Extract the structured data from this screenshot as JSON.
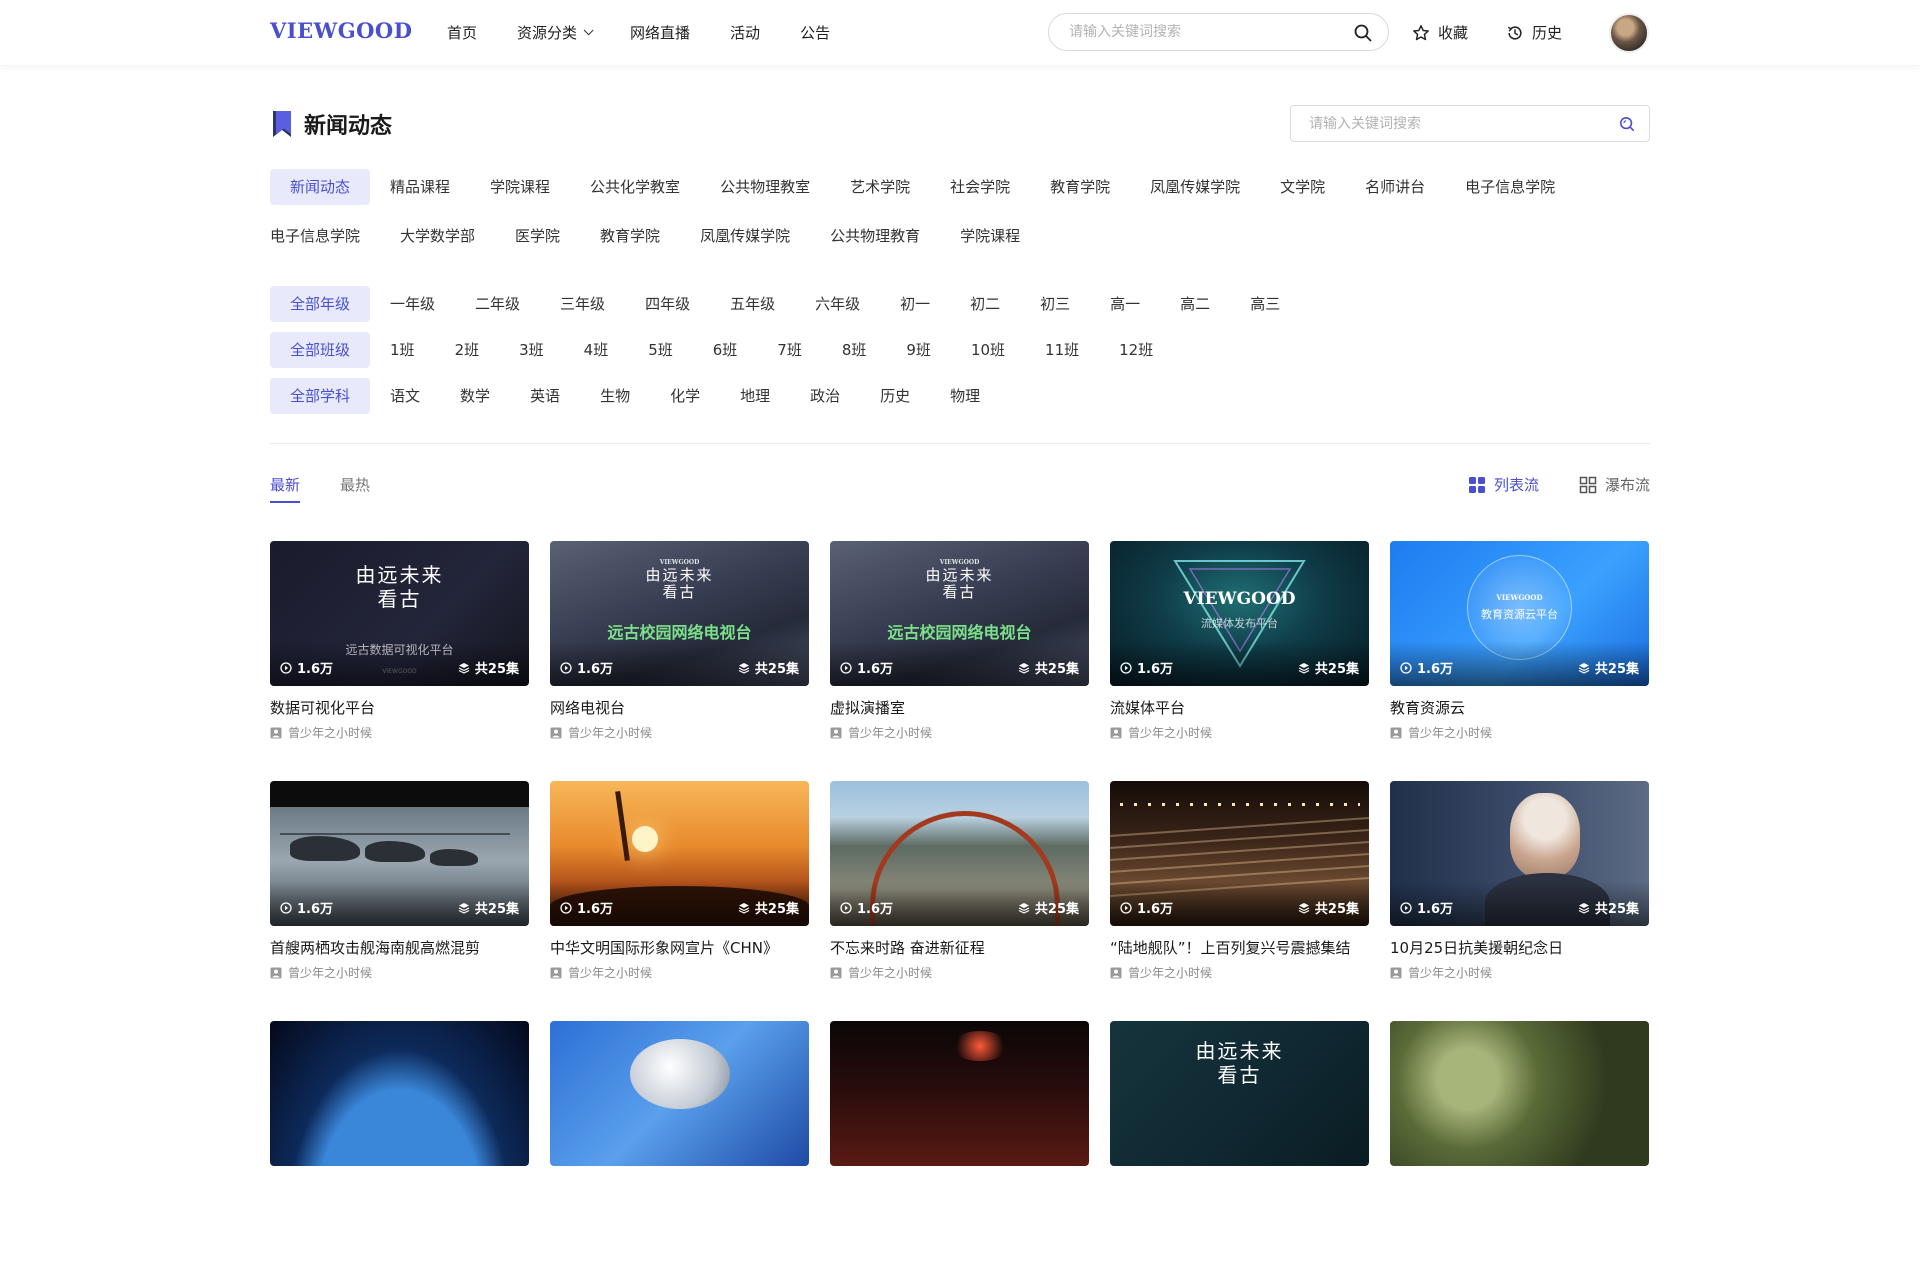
{
  "header": {
    "logo": "VIEWGOOD",
    "nav": [
      {
        "label": "首页",
        "dropdown": false
      },
      {
        "label": "资源分类",
        "dropdown": true
      },
      {
        "label": "网络直播",
        "dropdown": false
      },
      {
        "label": "活动",
        "dropdown": false
      },
      {
        "label": "公告",
        "dropdown": false
      }
    ],
    "search_placeholder": "请输入关键词搜索",
    "favorites_label": "收藏",
    "history_label": "历史"
  },
  "page": {
    "title": "新闻动态",
    "search_placeholder": "请输入关键词搜索"
  },
  "categories_row1": [
    "新闻动态",
    "精品课程",
    "学院课程",
    "公共化学教室",
    "公共物理教室",
    "艺术学院",
    "社会学院",
    "教育学院",
    "凤凰传媒学院",
    "文学院",
    "名师讲台",
    "电子信息学院"
  ],
  "categories_row2": [
    "电子信息学院",
    "大学数学部",
    "医学院",
    "教育学院",
    "凤凰传媒学院",
    "公共物理教育",
    "学院课程"
  ],
  "grades": [
    "全部年级",
    "一年级",
    "二年级",
    "三年级",
    "四年级",
    "五年级",
    "六年级",
    "初一",
    "初二",
    "初三",
    "高一",
    "高二",
    "高三"
  ],
  "classes": [
    "全部班级",
    "1班",
    "2班",
    "3班",
    "4班",
    "5班",
    "6班",
    "7班",
    "8班",
    "9班",
    "10班",
    "11班",
    "12班"
  ],
  "subjects": [
    "全部学科",
    "语文",
    "数学",
    "英语",
    "生物",
    "化学",
    "地理",
    "政治",
    "历史",
    "物理"
  ],
  "sort": [
    "最新",
    "最热"
  ],
  "view_modes": [
    "列表流",
    "瀑布流"
  ],
  "colors": {
    "accent": "#4a4fd0",
    "accent_bg": "#e8eafb"
  },
  "videos": [
    {
      "title": "数据可视化平台",
      "author": "曾少年之小时候",
      "views": "1.6万",
      "episodes": "共25集",
      "thumb_style": "calligraphy-dark",
      "thumb_calli": "由远未来看古",
      "thumb_sub": "远古数据可视化平台",
      "thumb_brand": "VIEWGOOD"
    },
    {
      "title": "网络电视台",
      "author": "曾少年之小时候",
      "views": "1.6万",
      "episodes": "共25集",
      "thumb_style": "campus-tv",
      "thumb_calli": "由远未来看古",
      "thumb_headline": "远古校园网络电视台",
      "thumb_brand": "VIEWGOOD"
    },
    {
      "title": "虚拟演播室",
      "author": "曾少年之小时候",
      "views": "1.6万",
      "episodes": "共25集",
      "thumb_style": "campus-tv",
      "thumb_calli": "由远未来看古",
      "thumb_headline": "远古校园网络电视台",
      "thumb_brand": "VIEWGOOD"
    },
    {
      "title": "流媒体平台",
      "author": "曾少年之小时候",
      "views": "1.6万",
      "episodes": "共25集",
      "thumb_style": "triangle",
      "thumb_brand": "VIEWGOOD",
      "thumb_sub": "流媒体发布平台"
    },
    {
      "title": "教育资源云",
      "author": "曾少年之小时候",
      "views": "1.6万",
      "episodes": "共25集",
      "thumb_style": "cloud",
      "thumb_brand": "VIEWGOOD",
      "thumb_sub": "教育资源云平台"
    },
    {
      "title": "首艘两栖攻击舰海南舰高燃混剪",
      "author": "曾少年之小时候",
      "views": "1.6万",
      "episodes": "共25集",
      "thumb_style": "helicopters"
    },
    {
      "title": "中华文明国际形象网宣片《CHN》",
      "author": "曾少年之小时候",
      "views": "1.6万",
      "episodes": "共25集",
      "thumb_style": "sunset"
    },
    {
      "title": "不忘来时路 奋进新征程",
      "author": "曾少年之小时候",
      "views": "1.6万",
      "episodes": "共25集",
      "thumb_style": "bridge"
    },
    {
      "title": "“陆地舰队”！上百列复兴号震撼集结",
      "author": "曾少年之小时候",
      "views": "1.6万",
      "episodes": "共25集",
      "thumb_style": "trains"
    },
    {
      "title": "10月25日抗美援朝纪念日",
      "author": "曾少年之小时候",
      "views": "1.6万",
      "episodes": "共25集",
      "thumb_style": "portrait"
    },
    {
      "title": "",
      "author": "",
      "views": "",
      "episodes": "",
      "thumb_style": "earth"
    },
    {
      "title": "",
      "author": "",
      "views": "",
      "episodes": "",
      "thumb_style": "astronaut"
    },
    {
      "title": "",
      "author": "",
      "views": "",
      "episodes": "",
      "thumb_style": "night"
    },
    {
      "title": "",
      "author": "",
      "views": "",
      "episodes": "",
      "thumb_style": "calligraphy-teal",
      "thumb_calli": "由远未来看古"
    },
    {
      "title": "",
      "author": "",
      "views": "",
      "episodes": "",
      "thumb_style": "trees"
    }
  ]
}
